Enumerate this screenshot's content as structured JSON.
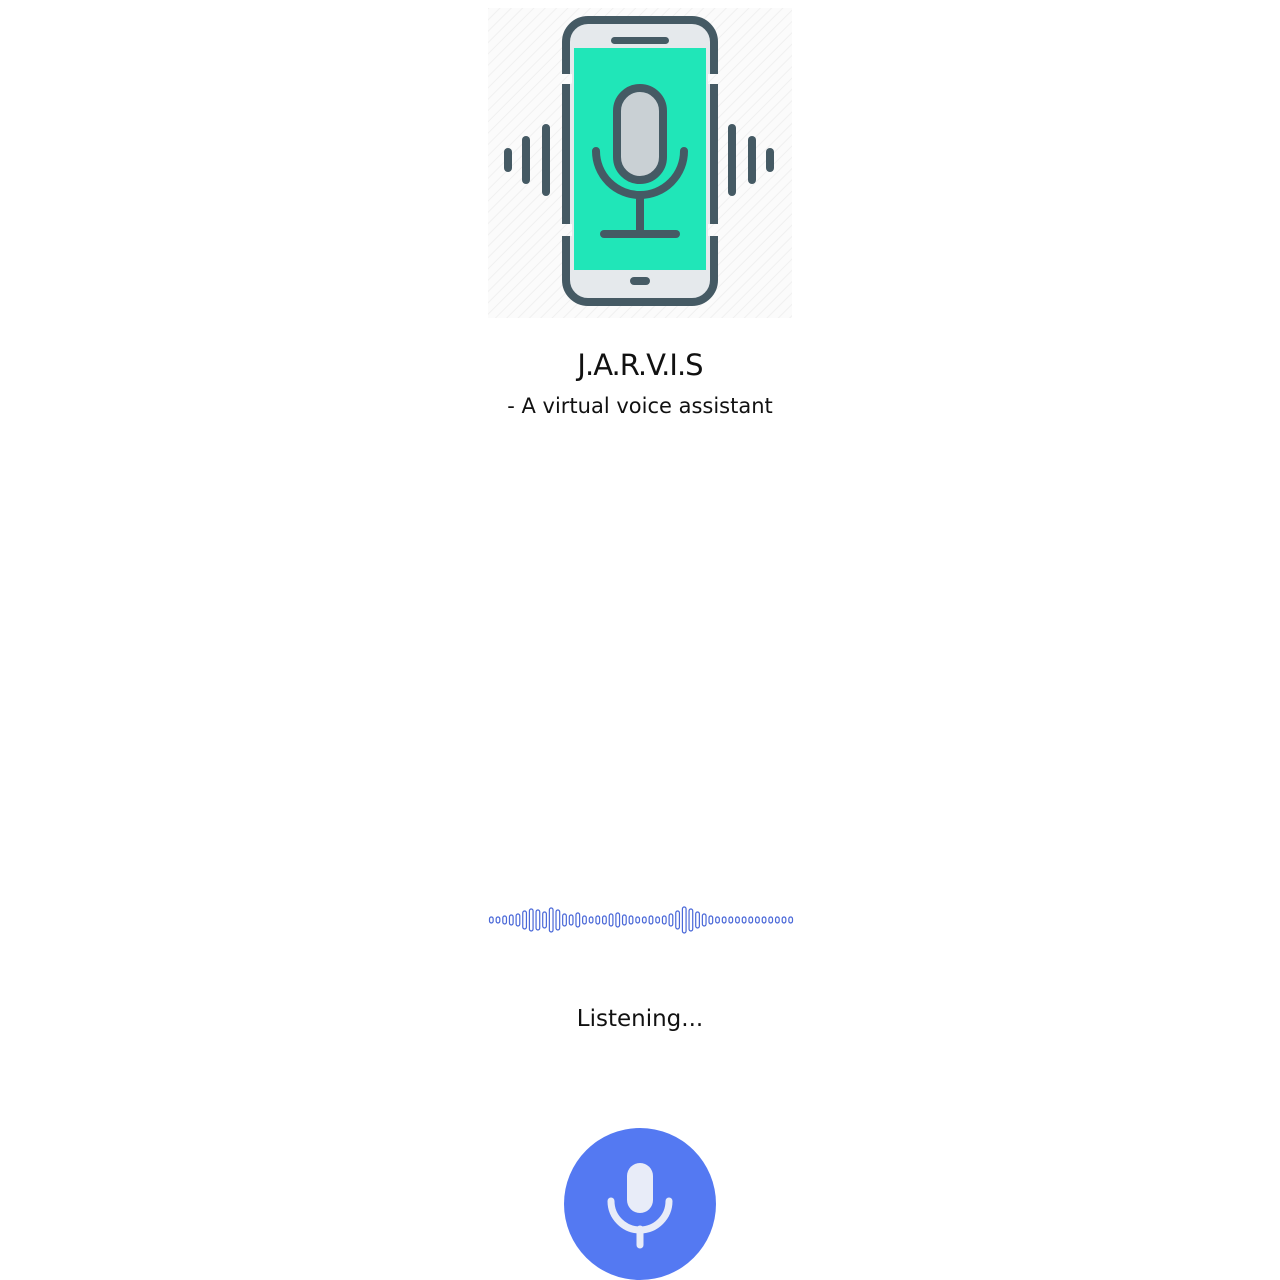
{
  "app": {
    "title": "J.A.R.V.I.S",
    "subtitle": "- A virtual voice assistant"
  },
  "status": {
    "text": "Listening..."
  },
  "icons": {
    "logo": "phone-microphone-icon",
    "waveform": "audio-waveform",
    "mic_button": "microphone-icon"
  },
  "colors": {
    "accent": "#5479f2",
    "logo_screen": "#20e6b8",
    "logo_outline": "#455a64",
    "waveform": "#4a68d8"
  },
  "waveform_levels": [
    0.15,
    0.15,
    0.2,
    0.25,
    0.3,
    0.45,
    0.55,
    0.5,
    0.4,
    0.6,
    0.5,
    0.3,
    0.25,
    0.35,
    0.2,
    0.15,
    0.2,
    0.2,
    0.3,
    0.35,
    0.25,
    0.2,
    0.15,
    0.15,
    0.2,
    0.15,
    0.2,
    0.3,
    0.45,
    0.65,
    0.55,
    0.4,
    0.3,
    0.2,
    0.15,
    0.15,
    0.15,
    0.15,
    0.15,
    0.15,
    0.15,
    0.15,
    0.15,
    0.15,
    0.15,
    0.15
  ]
}
